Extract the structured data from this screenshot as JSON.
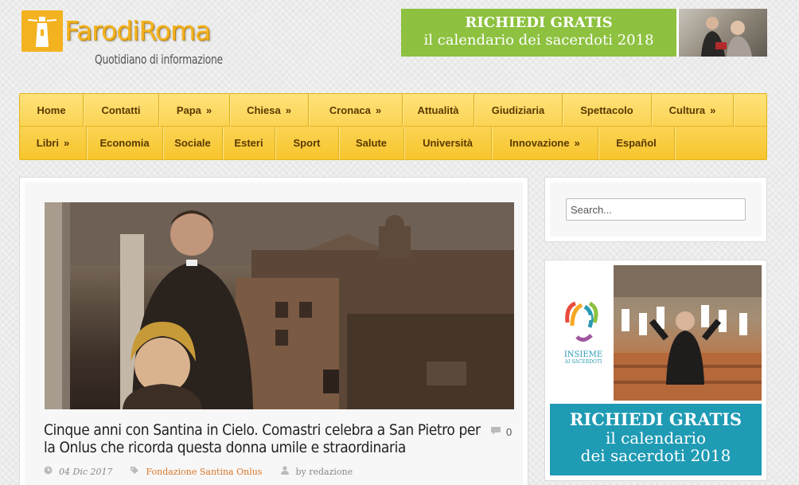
{
  "site": {
    "logo_title": "FarodiRoma",
    "logo_subtitle": "Quotidiano di informazione"
  },
  "top_banner": {
    "line1": "RICHIEDI GRATIS",
    "line2": "il calendario dei sacerdoti 2018"
  },
  "nav": {
    "row1": [
      {
        "label": "Home",
        "submenu": false
      },
      {
        "label": "Contatti",
        "submenu": false
      },
      {
        "label": "Papa",
        "submenu": true
      },
      {
        "label": "Chiesa",
        "submenu": true
      },
      {
        "label": "Cronaca",
        "submenu": true
      },
      {
        "label": "Attualità",
        "submenu": false
      },
      {
        "label": "Giudiziaria",
        "submenu": false
      },
      {
        "label": "Spettacolo",
        "submenu": false
      },
      {
        "label": "Cultura",
        "submenu": true
      }
    ],
    "row2": [
      {
        "label": "Libri",
        "submenu": true
      },
      {
        "label": "Economia",
        "submenu": false
      },
      {
        "label": "Sociale",
        "submenu": false
      },
      {
        "label": "Esteri",
        "submenu": false
      },
      {
        "label": "Sport",
        "submenu": false
      },
      {
        "label": "Salute",
        "submenu": false
      },
      {
        "label": "Università",
        "submenu": false
      },
      {
        "label": "Innovazione",
        "submenu": true
      },
      {
        "label": "Español",
        "submenu": false
      }
    ],
    "submenu_glyph": "»"
  },
  "article": {
    "title": "Cinque anni con Santina in Cielo. Comastri celebra a San Pietro per la Onlus che ricorda questa donna umile e straordinaria",
    "comment_count": "0",
    "date": "04 Dic 2017",
    "tag": "Fondazione Santina Onlus",
    "author": "by redazione"
  },
  "sidebar": {
    "search_placeholder": "Search...",
    "ad": {
      "logo_text": "INSIEME",
      "logo_sub": "AI SACERDOTI",
      "line1": "RICHIEDI GRATIS",
      "line2": "il calendario",
      "line3": "dei sacerdoti 2018"
    }
  },
  "colors": {
    "brand": "#f3b21f",
    "nav_text": "#5a3a00",
    "banner_green": "#8dc13f",
    "ad_teal": "#1f9bb4",
    "tag_orange": "#d9782a"
  }
}
